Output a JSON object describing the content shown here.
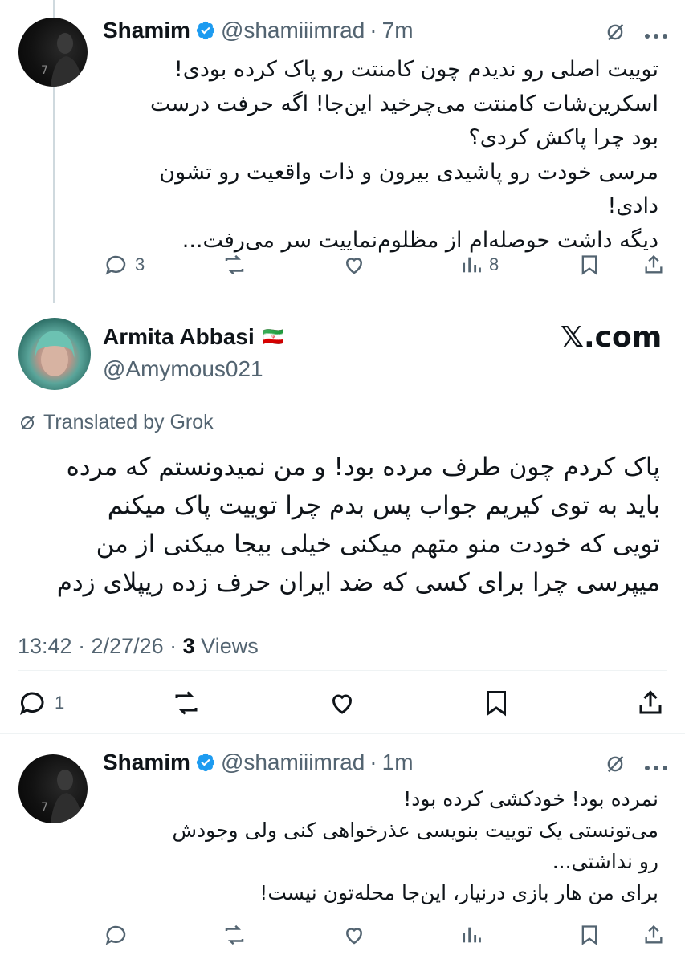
{
  "reply1": {
    "name": "Shamim",
    "handle": "@shamiiimrad",
    "dot": "·",
    "time": "7m",
    "lines": [
      "توییت اصلی رو ندیدم چون کامنتت رو پاک کرده بودی!",
      "اسکرین‌شات کامنتت می‌چرخید این‌جا! اگه حرفت درست",
      "بود چرا پاکش کردی؟",
      "مرسی خودت رو پاشیدی بیرون و ذات واقعیت رو تشون",
      "دادی!",
      "دیگه داشت حوصله‌ام از مظلوم‌نماییت سر می‌رفت..."
    ],
    "reply_count": "3",
    "views_count": "8"
  },
  "main": {
    "name": "Armita Abbasi",
    "flag": "🇮🇷",
    "handle": "@Amymous021",
    "brand": "𝕏.com",
    "translated_label": "Translated by Grok",
    "lines": [
      "پاک کردم چون طرف مرده بود! و من نمیدونستم که مرده",
      "باید به توی کیریم جواب پس بدم چرا توییت پاک میکنم",
      "تویی که خودت منو متهم میکنی خیلی بیجا میکنی از من",
      "میپرسی چرا برای کسی که ضد ایران حرف زده ریپلای زدم"
    ],
    "meta_time": "13:42 · 2/27/26 · ",
    "meta_views_count": "3",
    "meta_views_label": " Views",
    "reply_count": "1"
  },
  "reply2": {
    "name": "Shamim",
    "handle": "@shamiiimrad",
    "dot": "·",
    "time": "1m",
    "lines": [
      "نمرده بود! خودکشی کرده بود!",
      "می‌تونستی یک توییت بنویسی عذرخواهی کنی ولی وجودش",
      "رو نداشتی...",
      "برای من هار بازی درنیار، این‌جا محله‌تون نیست!"
    ]
  },
  "colors": {
    "verified": "#1d9bf0",
    "muted": "#536471",
    "text": "#0f1419"
  }
}
